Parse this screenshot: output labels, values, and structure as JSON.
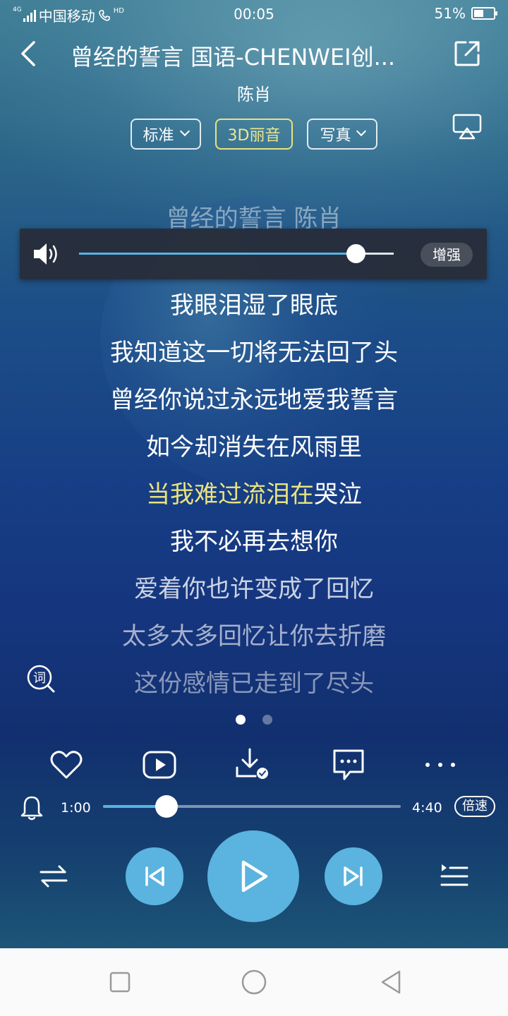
{
  "status_bar": {
    "network_tag": "4G",
    "carrier": "中国移动",
    "hd_tag": "HD",
    "time": "00:05",
    "battery_percent": "51%",
    "battery_level": 0.51
  },
  "header": {
    "title": "曾经的誓言 国语-CHENWEI创...",
    "artist": "陈肖"
  },
  "chips": [
    {
      "label": "标准",
      "has_dropdown": true,
      "active": false
    },
    {
      "label": "3D丽音",
      "has_dropdown": false,
      "active": true
    },
    {
      "label": "写真",
      "has_dropdown": true,
      "active": false
    }
  ],
  "lyrics": {
    "title_line": "曾经的誓言 陈肖",
    "lines": [
      "我眼泪湿了眼底",
      "我知道这一切将无法回了头",
      "曾经你说过永远地爱我誓言",
      "如今却消失在风雨里",
      "当我难过流泪在哭泣",
      "我不必再去想你",
      "爱着你也许变成了回忆",
      "太多太多回忆让你去折磨",
      "这份感情已走到了尽头"
    ],
    "current_line_index": 4,
    "current_line_sung": "当我难过流泪在",
    "current_line_rest": "哭泣"
  },
  "volume_popup": {
    "level": 0.88,
    "boost_label": "增强"
  },
  "lyric_button_label": "词",
  "pager": {
    "count": 2,
    "active": 0
  },
  "actions": [
    "heart-icon",
    "video-icon",
    "download-icon",
    "comment-icon",
    "more-icon"
  ],
  "progress": {
    "current": "1:00",
    "total": "4:40",
    "fraction": 0.214,
    "speed_label": "倍速"
  },
  "colors": {
    "accent_blue": "#57b3e4",
    "control_blue": "#5bb3df",
    "highlight_yellow": "#e9e37e"
  }
}
